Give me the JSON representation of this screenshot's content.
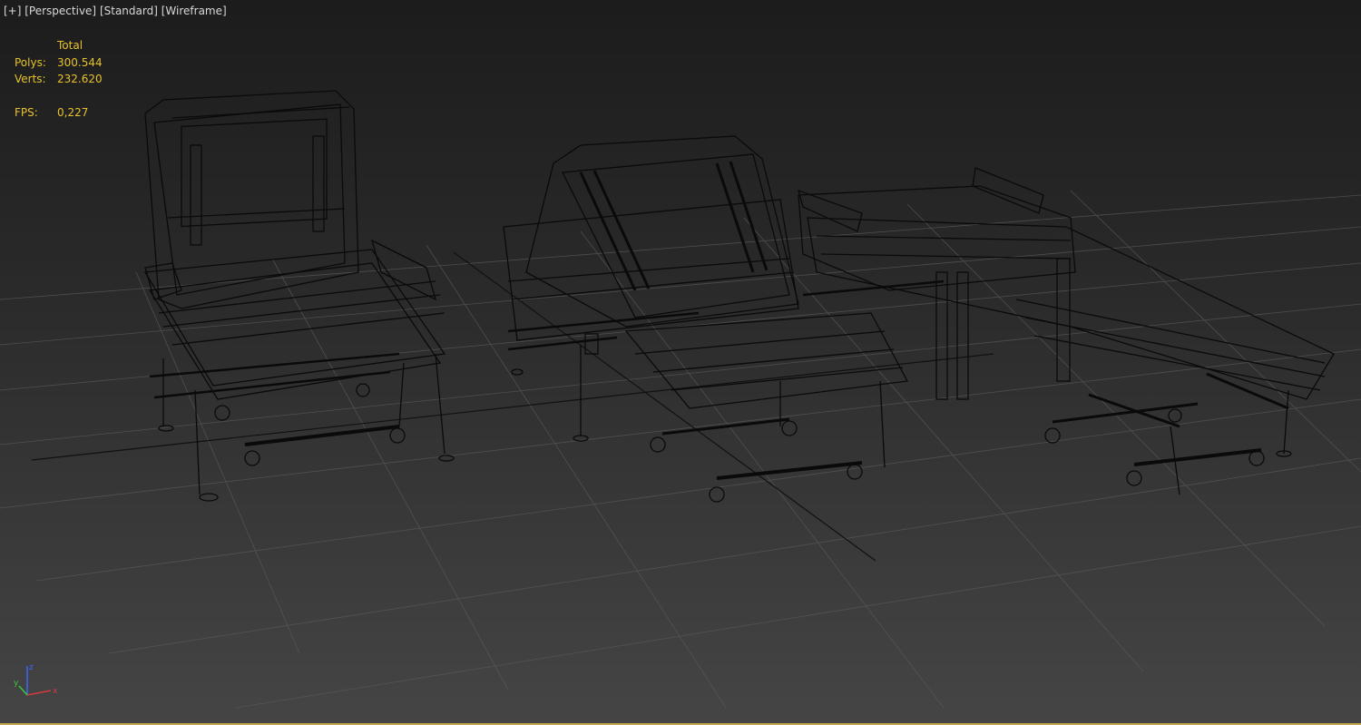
{
  "viewport": {
    "menu": {
      "plus": "[+]",
      "view": "[Perspective]",
      "shading_preset": "[Standard]",
      "shading_mode": "[Wireframe]"
    },
    "stats": {
      "header": "Total",
      "polys_label": "Polys:",
      "polys_value": "300.544",
      "verts_label": "Verts:",
      "verts_value": "232.620",
      "fps_label": "FPS:",
      "fps_value": "0,227"
    },
    "axis_gizmo": {
      "x": "x",
      "y": "y",
      "z": "z"
    }
  },
  "colors": {
    "stats_text": "#e8c22a",
    "menu_text": "#d8d8d8",
    "wireframe": "#0a0a0a",
    "grid": "#5a5a5a",
    "border_accent": "#c7a64a",
    "axis_x": "#d23c3c",
    "axis_y": "#3cc83c",
    "axis_z": "#3c64ff"
  },
  "icons": [
    "axis-tripod-icon"
  ]
}
